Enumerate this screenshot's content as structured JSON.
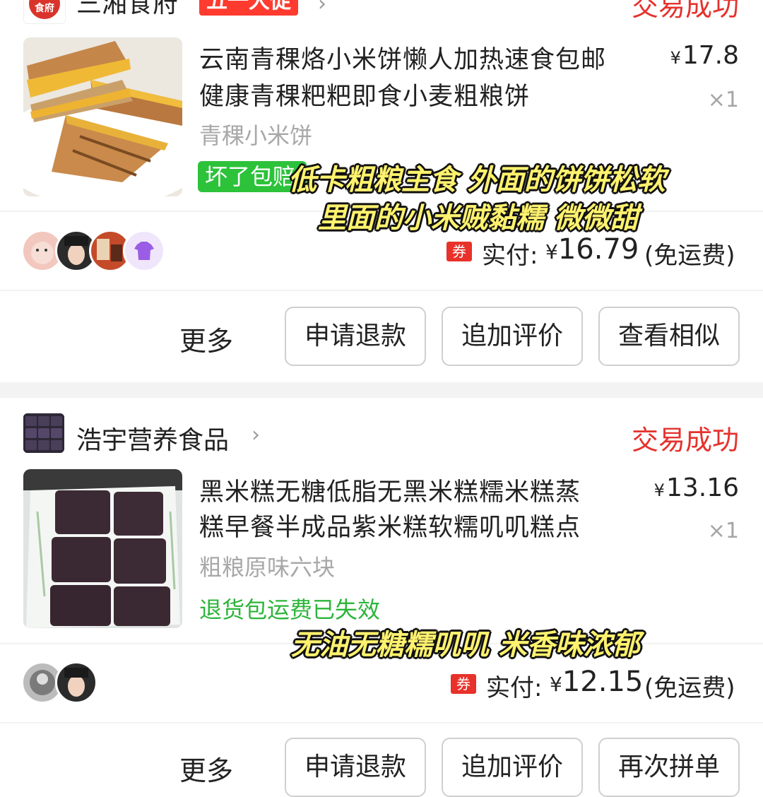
{
  "orders": [
    {
      "shop_name": "三湘食府",
      "logo_text": "食府",
      "promo_badge": "五一大促",
      "status": "交易成功",
      "title_lines": [
        "云南青稞烙小米饼懒人加热速食包邮",
        "健康青稞粑粑即食小麦粗粮饼"
      ],
      "sku": "青稞小米饼",
      "tag": "坏了包赔",
      "price": "17.8",
      "currency": "¥",
      "qty": "×1",
      "coupon_label": "券",
      "paid_label": "实付:",
      "paid_amount": "16.79",
      "shipping_note": "(免运费)",
      "buttons": {
        "more": "更多",
        "refund": "申请退款",
        "review": "追加评价",
        "action": "查看相似"
      }
    },
    {
      "shop_name": "浩宇营养食品",
      "status": "交易成功",
      "title_lines": [
        "黑米糕无糖低脂无黑米糕糯米糕蒸",
        "糕早餐半成品紫米糕软糯叽叽糕点"
      ],
      "sku": "粗粮原味六块",
      "notice": "退货包运费已失效",
      "price": "13.16",
      "currency": "¥",
      "qty": "×1",
      "coupon_label": "券",
      "paid_label": "实付:",
      "paid_amount": "12.15",
      "shipping_note": "(免运费)",
      "buttons": {
        "more": "更多",
        "refund": "申请退款",
        "review": "追加评价",
        "action": "再次拼单"
      }
    }
  ],
  "captions": {
    "first_line1": "低卡粗粮主食 外面的饼饼松软",
    "first_line2": "里面的小米贼黏糯 微微甜",
    "second": "无油无糖糯叽叽 米香味浓郁"
  },
  "colors": {
    "status_red": "#e5322d",
    "tag_green": "#2cc23a",
    "caption_yellow": "#fff26e",
    "coupon_red": "#e8312a"
  }
}
